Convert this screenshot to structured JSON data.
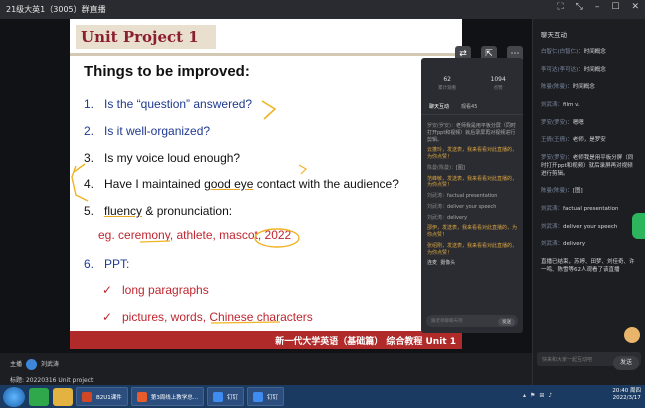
{
  "window": {
    "title": "21级大英1（3005）群直播",
    "controls": [
      "⛶",
      "⤡",
      "–",
      "☐",
      "✕"
    ]
  },
  "slide": {
    "unit_title": "Unit Project 1",
    "heading": "Things to be improved:",
    "items": [
      {
        "num": "1.",
        "text": "Is the “question” answered?"
      },
      {
        "num": "2.",
        "text": "Is it well-organized?"
      },
      {
        "num": "3.",
        "text": "Is my voice loud enough?"
      },
      {
        "num": "4.",
        "text_a": "Have I maintained ",
        "text_b": "good eye",
        "text_c": " contact with the audience?"
      },
      {
        "num": "5.",
        "text_a": "fluency",
        "text_b": " & pronunciation:"
      },
      {
        "num": "6.",
        "text": "PPT:"
      }
    ],
    "example": "eg. ceremony, athlete, mascot, 2022",
    "bullets": [
      "long paragraphs",
      "pictures, words, Chinese characters"
    ],
    "check": "✓",
    "footer": "新一代大学英语（基础篇） 综合教程  Unit 1"
  },
  "overlay": {
    "stats": [
      {
        "value": "62",
        "label": "累计观看"
      },
      {
        "value": "1094",
        "label": "点赞"
      }
    ],
    "tabs": [
      "聊天互动",
      "观看45"
    ],
    "messages": [
      {
        "name": "罗安(罗安)：",
        "text": "老师我是用平板分屏（同时打开ppt和视频）就后录屏再对视频进行剪辑。"
      },
      {
        "name": "",
        "text": "云蓬玲，发送表，我来看看对此直播的，为你点赞！",
        "orange": true
      },
      {
        "name": "陈曼(陈曼)：",
        "text": "[图]"
      },
      {
        "name": "",
        "text": "范峰敏，发送表，我来看看对此直播的，为你点赞！",
        "orange": true
      },
      {
        "name": "刘武涛：",
        "text": "factual presentation"
      },
      {
        "name": "刘武涛：",
        "text": "deliver your speech"
      },
      {
        "name": "刘武涛：",
        "text": "delivery"
      },
      {
        "name": "",
        "text": "邵伊，发送表，我来看看对此直播的，为你点赞！",
        "orange": true
      },
      {
        "name": "",
        "text": "张绍刚，发送表，我来看看对此直播的，为你点赞！",
        "orange": true
      }
    ],
    "mic_label": "连麦",
    "camera_label": "摄像头",
    "input_placeholder": "跟老师聊聊天吧",
    "send_label": "发送"
  },
  "chat": {
    "header": "聊天互动",
    "messages": [
      {
        "name": "白智仁(白智仁)：",
        "text": "时间概念"
      },
      {
        "name": "李可达(李可达)：",
        "text": "时间概念"
      },
      {
        "name": "陈曼(陈曼)：",
        "text": "时间概念"
      },
      {
        "name": "刘武涛：",
        "text": "film v."
      },
      {
        "name": "罗安(罗安)：",
        "text": "嗯嗯"
      },
      {
        "name": "王倩(王倩)：",
        "text": "老师，是罗安"
      },
      {
        "name": "罗安(罗安)：",
        "text": "老师我是用平板分屏（同时打开ppt和视频）就后录屏再对视频进行剪辑。"
      },
      {
        "name": "陈曼(陈曼)：",
        "text": "[图]"
      },
      {
        "name": "刘武涛：",
        "text": "factual presentation"
      },
      {
        "name": "刘武涛：",
        "text": "deliver your speech"
      },
      {
        "name": "刘武涛：",
        "text": "delivery"
      },
      {
        "name": "",
        "text": "直播已结束，苏婷、田梦、刘佳奇、许一鸣、陈雪等62人观看了该直播"
      }
    ],
    "input_placeholder": "快来和大家一起互动吧",
    "send_label": "发送"
  },
  "host": {
    "label": "主播",
    "name": "刘武涛",
    "subject_label": "标题:",
    "subject": "20220316 Unit project"
  },
  "taskbar": {
    "items": [
      "B2U1课件",
      "第3周线上教学总...",
      "钉钉",
      "钉钉"
    ],
    "time": "20:40 周四",
    "date": "2022/3/17"
  }
}
